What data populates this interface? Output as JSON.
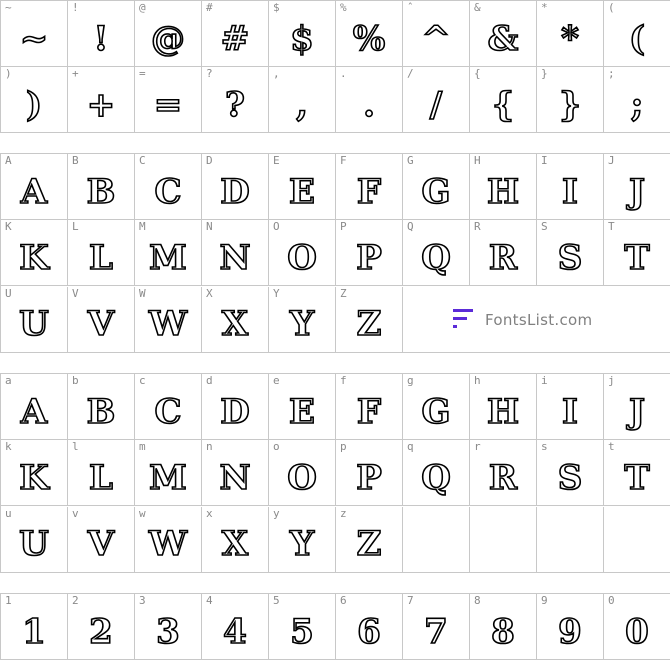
{
  "groups": {
    "symbols": [
      [
        "~",
        "~"
      ],
      [
        "!",
        "!"
      ],
      [
        "@",
        "@"
      ],
      [
        "#",
        "#"
      ],
      [
        "$",
        "$"
      ],
      [
        "%",
        "%"
      ],
      [
        "ˆ",
        "^"
      ],
      [
        "&",
        "&"
      ],
      [
        "*",
        "*"
      ],
      [
        "(",
        "("
      ],
      [
        ")",
        ")"
      ],
      [
        "+",
        "+"
      ],
      [
        "=",
        "="
      ],
      [
        "?",
        "?"
      ],
      [
        ",",
        ","
      ],
      [
        ".",
        "."
      ],
      [
        "/",
        "/"
      ],
      [
        "{",
        "{"
      ],
      [
        "}",
        "}"
      ],
      [
        ";",
        ";"
      ]
    ],
    "upper": [
      [
        "A",
        "A"
      ],
      [
        "B",
        "B"
      ],
      [
        "C",
        "C"
      ],
      [
        "D",
        "D"
      ],
      [
        "E",
        "E"
      ],
      [
        "F",
        "F"
      ],
      [
        "G",
        "G"
      ],
      [
        "H",
        "H"
      ],
      [
        "I",
        "I"
      ],
      [
        "J",
        "J"
      ],
      [
        "K",
        "K"
      ],
      [
        "L",
        "L"
      ],
      [
        "M",
        "M"
      ],
      [
        "N",
        "N"
      ],
      [
        "O",
        "O"
      ],
      [
        "P",
        "P"
      ],
      [
        "Q",
        "Q"
      ],
      [
        "R",
        "R"
      ],
      [
        "S",
        "S"
      ],
      [
        "T",
        "T"
      ],
      [
        "U",
        "U"
      ],
      [
        "V",
        "V"
      ],
      [
        "W",
        "W"
      ],
      [
        "X",
        "X"
      ],
      [
        "Y",
        "Y"
      ],
      [
        "Z",
        "Z"
      ]
    ],
    "lower": [
      [
        "a",
        "A"
      ],
      [
        "b",
        "B"
      ],
      [
        "c",
        "C"
      ],
      [
        "d",
        "D"
      ],
      [
        "e",
        "E"
      ],
      [
        "f",
        "F"
      ],
      [
        "g",
        "G"
      ],
      [
        "h",
        "H"
      ],
      [
        "i",
        "I"
      ],
      [
        "j",
        "J"
      ],
      [
        "k",
        "K"
      ],
      [
        "l",
        "L"
      ],
      [
        "m",
        "M"
      ],
      [
        "n",
        "N"
      ],
      [
        "o",
        "O"
      ],
      [
        "p",
        "P"
      ],
      [
        "q",
        "Q"
      ],
      [
        "r",
        "R"
      ],
      [
        "s",
        "S"
      ],
      [
        "t",
        "T"
      ],
      [
        "u",
        "U"
      ],
      [
        "v",
        "V"
      ],
      [
        "w",
        "W"
      ],
      [
        "x",
        "X"
      ],
      [
        "y",
        "Y"
      ],
      [
        "z",
        "Z"
      ]
    ],
    "digits": [
      [
        "1",
        "1"
      ],
      [
        "2",
        "2"
      ],
      [
        "3",
        "3"
      ],
      [
        "4",
        "4"
      ],
      [
        "5",
        "5"
      ],
      [
        "6",
        "6"
      ],
      [
        "7",
        "7"
      ],
      [
        "8",
        "8"
      ],
      [
        "9",
        "9"
      ],
      [
        "0",
        "0"
      ]
    ]
  },
  "watermark": {
    "text": "FontsList.com",
    "brand_color": "#5b2bd8"
  }
}
